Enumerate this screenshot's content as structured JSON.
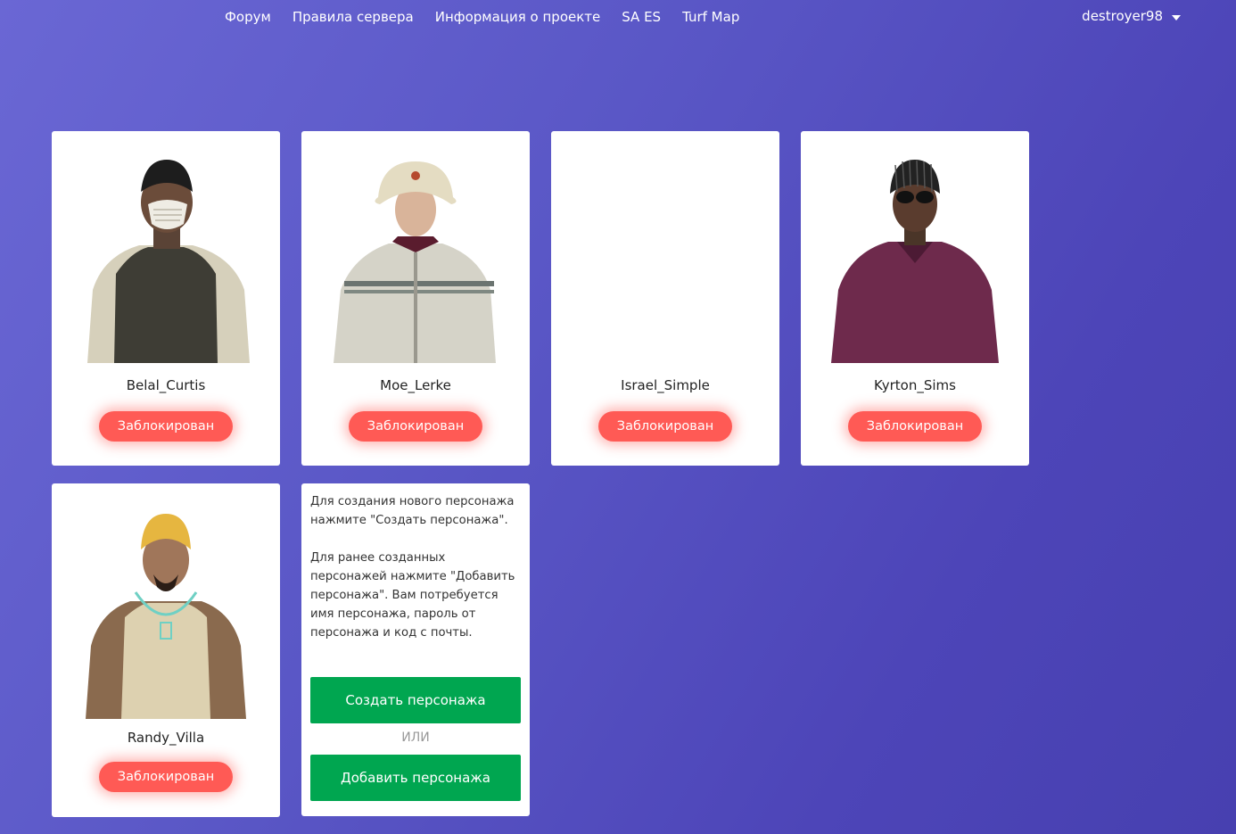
{
  "nav": {
    "links": [
      "Форум",
      "Правила сервера",
      "Информация о проекте",
      "SA ES",
      "Turf Map"
    ],
    "username": "destroyer98"
  },
  "characters": [
    {
      "name": "Belal_Curtis",
      "status": "Заблокирован"
    },
    {
      "name": "Moe_Lerke",
      "status": "Заблокирован"
    },
    {
      "name": "Israel_Simple",
      "status": "Заблокирован"
    },
    {
      "name": "Kyrton_Sims",
      "status": "Заблокирован"
    },
    {
      "name": "Randy_Villa",
      "status": "Заблокирован"
    }
  ],
  "info": {
    "text1": "Для создания нового персонажа нажмите \"Создать персонажа\".",
    "text2": "Для ранее созданных персонажей нажмите \"Добавить персонажа\". Вам потребуется имя персонажа, пароль от персонажа и код с почты.",
    "create_label": "Создать персонажа",
    "or_label": "ИЛИ",
    "add_label": "Добавить персонажа"
  },
  "colors": {
    "status_red": "#ff5a55",
    "action_green": "#00a650",
    "background": "#5a57c6"
  }
}
